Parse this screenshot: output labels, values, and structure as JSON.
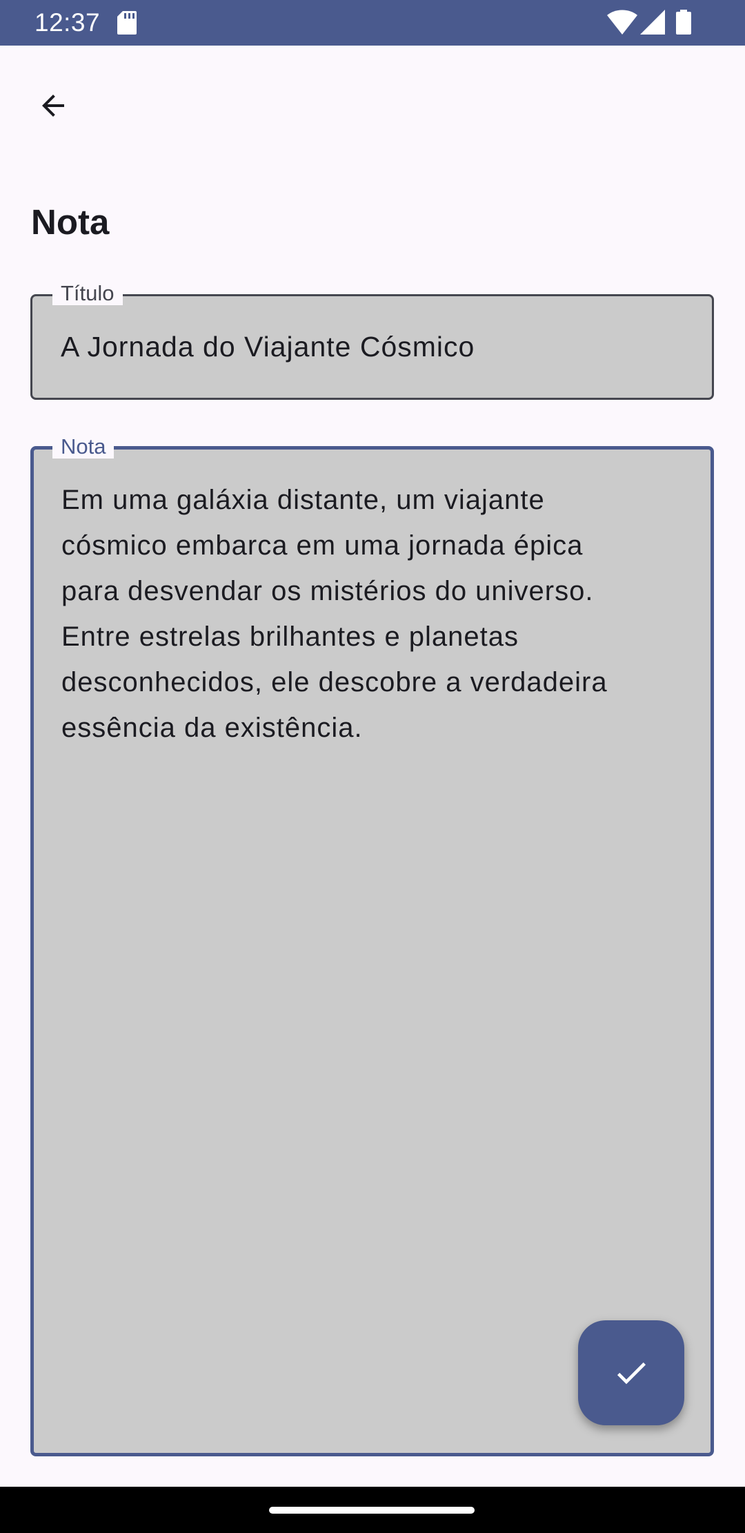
{
  "status_bar": {
    "time": "12:37",
    "icons": [
      "sd-card-icon",
      "wifi-icon",
      "signal-icon",
      "battery-icon"
    ]
  },
  "toolbar": {
    "back_icon": "arrow-back-icon"
  },
  "page": {
    "title": "Nota"
  },
  "form": {
    "title_field": {
      "label": "Título",
      "value": "A Jornada do Viajante Cósmico"
    },
    "note_field": {
      "label": "Nota",
      "value": "Em uma galáxia distante, um viajante\ncósmico embarca em uma jornada épica\npara desvendar os mistérios do universo.\nEntre estrelas brilhantes e planetas\ndesconhecidos, ele descobre a verdadeira\nessência da existência."
    }
  },
  "fab": {
    "icon": "check-icon"
  },
  "colors": {
    "primary": "#4A5A8E",
    "background": "#FCF8FD",
    "field_fill": "#CBCBCB",
    "outline": "#45464F",
    "text": "#1B1B21"
  }
}
